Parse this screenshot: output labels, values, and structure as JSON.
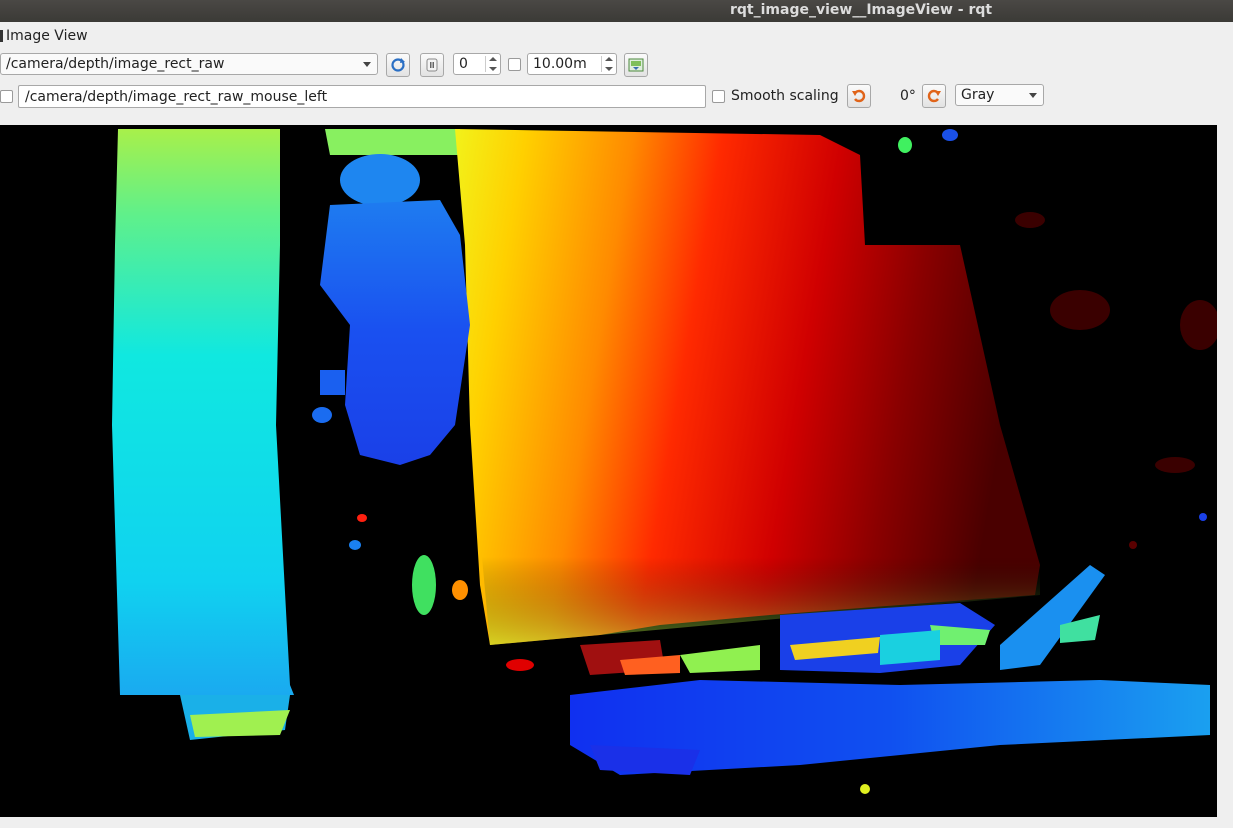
{
  "window": {
    "title": "rqt_image_view__ImageView - rqt"
  },
  "plugin": {
    "label": "Image View"
  },
  "toolbar": {
    "topic": "/camera/depth/image_rect_raw",
    "refresh_icon": "refresh-icon",
    "pause_icon": "pause-icon",
    "min_value": "0",
    "max_value": "10.00m",
    "save_icon": "save-image-icon"
  },
  "toolbar2": {
    "mouse_topic": "/camera/depth/image_rect_raw_mouse_left",
    "smooth_label": "Smooth scaling",
    "rotate_left_icon": "rotate-ccw-icon",
    "rotation": "0°",
    "rotate_right_icon": "rotate-cw-icon",
    "colormap": "Gray"
  },
  "image": {
    "kind": "depth colormap (jet)"
  }
}
